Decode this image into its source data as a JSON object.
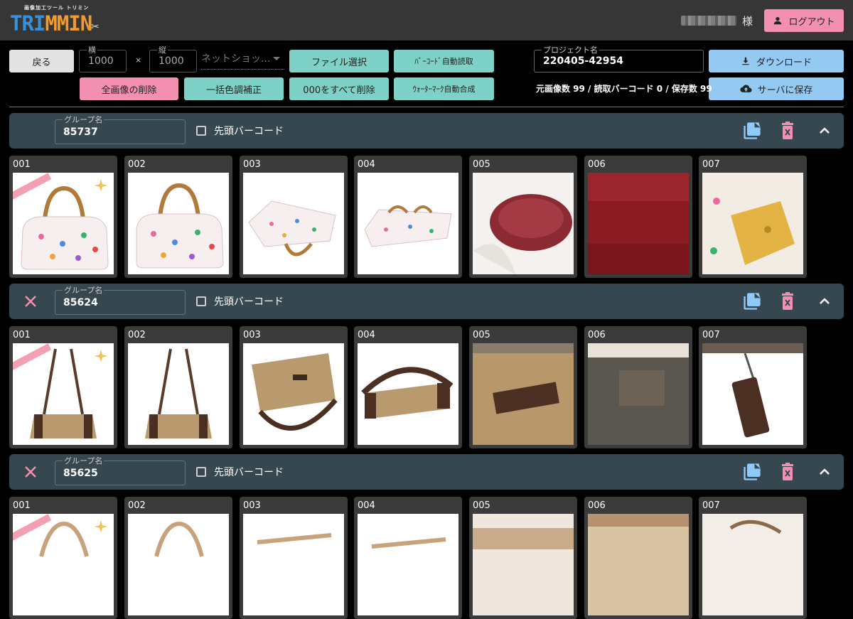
{
  "app": {
    "logo_tagline": "画像加工ツール トリミン",
    "logo_word_blue": "TRI",
    "logo_word_orange": "MMIN",
    "user_suffix": "様",
    "logout_label": "ログアウト"
  },
  "toolbar": {
    "back_label": "戻る",
    "width_label": "横",
    "width_value": "1000",
    "times": "×",
    "height_label": "縦",
    "height_value": "1000",
    "preset_value": "ネットショッ...",
    "file_select_label": "ファイル選択",
    "barcode_auto_label": "ﾊﾞｰｺｰﾄﾞ自動読取",
    "delete_all_images_label": "全画像の削除",
    "color_correct_label": "一括色調補正",
    "delete_000_label": "000をすべて削除",
    "watermark_label": "ｳｫｰﾀｰﾏｰｸ自動合成",
    "project_label": "プロジェクト名",
    "project_value": "220405-42954",
    "download_label": "ダウンロード",
    "save_server_label": "サーバに保存",
    "stats": "元画像数 99 / 読取バーコード 0 / 保存数 99"
  },
  "group_common": {
    "name_label": "グループ名",
    "leading_barcode_label": "先頭バーコード"
  },
  "groups": [
    {
      "name": "85737",
      "removable": false,
      "images": [
        {
          "no": "001",
          "watermark": true
        },
        {
          "no": "002"
        },
        {
          "no": "003"
        },
        {
          "no": "004"
        },
        {
          "no": "005"
        },
        {
          "no": "006"
        },
        {
          "no": "007"
        }
      ]
    },
    {
      "name": "85624",
      "removable": true,
      "images": [
        {
          "no": "001",
          "watermark": true
        },
        {
          "no": "002"
        },
        {
          "no": "003"
        },
        {
          "no": "004"
        },
        {
          "no": "005"
        },
        {
          "no": "006"
        },
        {
          "no": "007"
        }
      ]
    },
    {
      "name": "85625",
      "removable": true,
      "images": [
        {
          "no": "001",
          "watermark": true
        },
        {
          "no": "002"
        },
        {
          "no": "003"
        },
        {
          "no": "004"
        },
        {
          "no": "005"
        },
        {
          "no": "006"
        },
        {
          "no": "007"
        }
      ]
    }
  ],
  "colors": {
    "header_bg": "#363636",
    "group_bar_bg": "#37474f",
    "accent_pink": "#f38fb0",
    "accent_teal": "#7dd1c6",
    "accent_blue": "#94c9f2",
    "icon_blue": "#90caf9",
    "icon_pink": "#f48fb1"
  },
  "icons": {
    "logout": "person-icon",
    "download": "download-icon",
    "save_server": "cloud-upload-icon",
    "remove_group": "close-icon",
    "copy_group": "file-copy-icon",
    "delete_group": "delete-forever-icon",
    "collapse_group": "chevron-up-icon",
    "logo_mark": "scissors-icon"
  }
}
